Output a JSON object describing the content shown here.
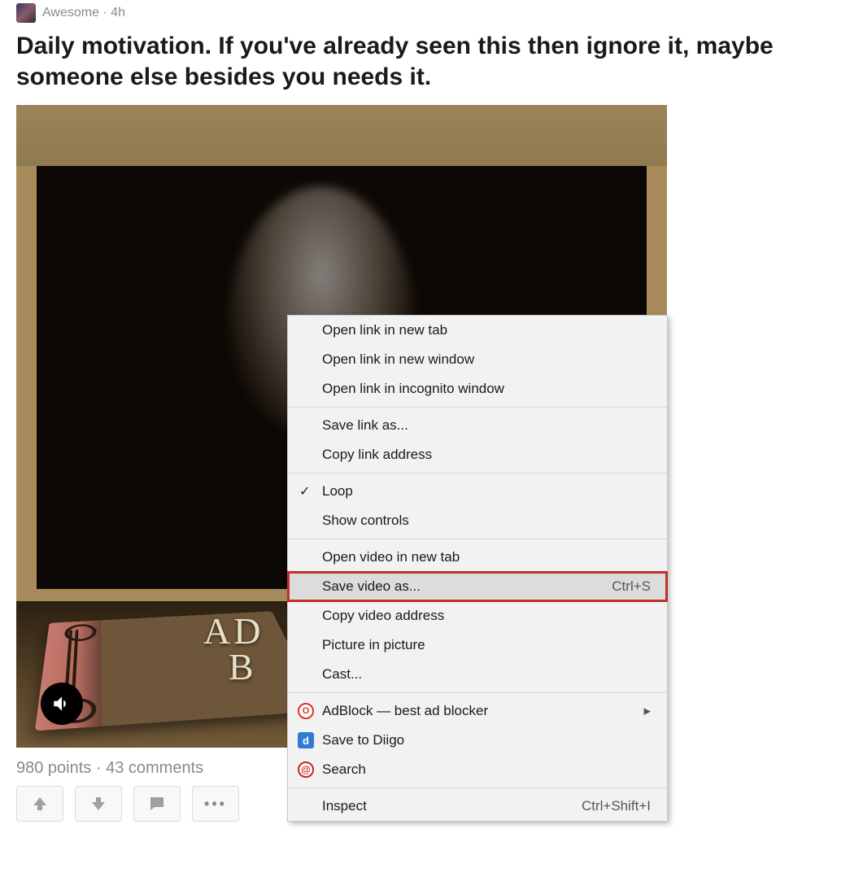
{
  "post": {
    "author": "Awesome",
    "timestamp": "4h",
    "separator": " · ",
    "title": "Daily motivation. If you've already seen this then ignore it, maybe someone else besides you needs it.",
    "points": "980 points",
    "comments": "43 comments",
    "book_line1": "AD",
    "book_line2": "B"
  },
  "context_menu": {
    "groups": [
      [
        {
          "label": "Open link in new tab"
        },
        {
          "label": "Open link in new window"
        },
        {
          "label": "Open link in incognito window"
        }
      ],
      [
        {
          "label": "Save link as..."
        },
        {
          "label": "Copy link address"
        }
      ],
      [
        {
          "label": "Loop",
          "checked": true
        },
        {
          "label": "Show controls"
        }
      ],
      [
        {
          "label": "Open video in new tab"
        },
        {
          "label": "Save video as...",
          "shortcut": "Ctrl+S",
          "highlighted": true
        },
        {
          "label": "Copy video address"
        },
        {
          "label": "Picture in picture"
        },
        {
          "label": "Cast..."
        }
      ],
      [
        {
          "label": "AdBlock — best ad blocker",
          "icon": "adblock",
          "submenu": true
        },
        {
          "label": "Save to Diigo",
          "icon": "diigo"
        },
        {
          "label": "Search",
          "icon": "pinterest"
        }
      ],
      [
        {
          "label": "Inspect",
          "shortcut": "Ctrl+Shift+I"
        }
      ]
    ]
  }
}
